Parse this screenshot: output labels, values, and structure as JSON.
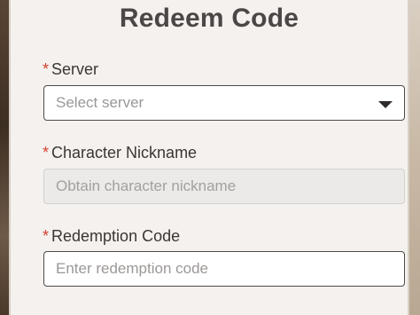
{
  "form": {
    "title": "Redeem Code",
    "required_marker": "*",
    "server": {
      "label": "Server",
      "placeholder": "Select server",
      "icon": "chevron-down-icon"
    },
    "nickname": {
      "label": "Character Nickname",
      "placeholder": "Obtain character nickname"
    },
    "code": {
      "label": "Redemption Code",
      "placeholder": "Enter redemption code",
      "value": ""
    }
  },
  "colors": {
    "required": "#d6402f",
    "title": "#4a4746",
    "panel_bg": "#f4f1ee",
    "border": "#4d4a48",
    "disabled_bg": "#ebeae9"
  }
}
